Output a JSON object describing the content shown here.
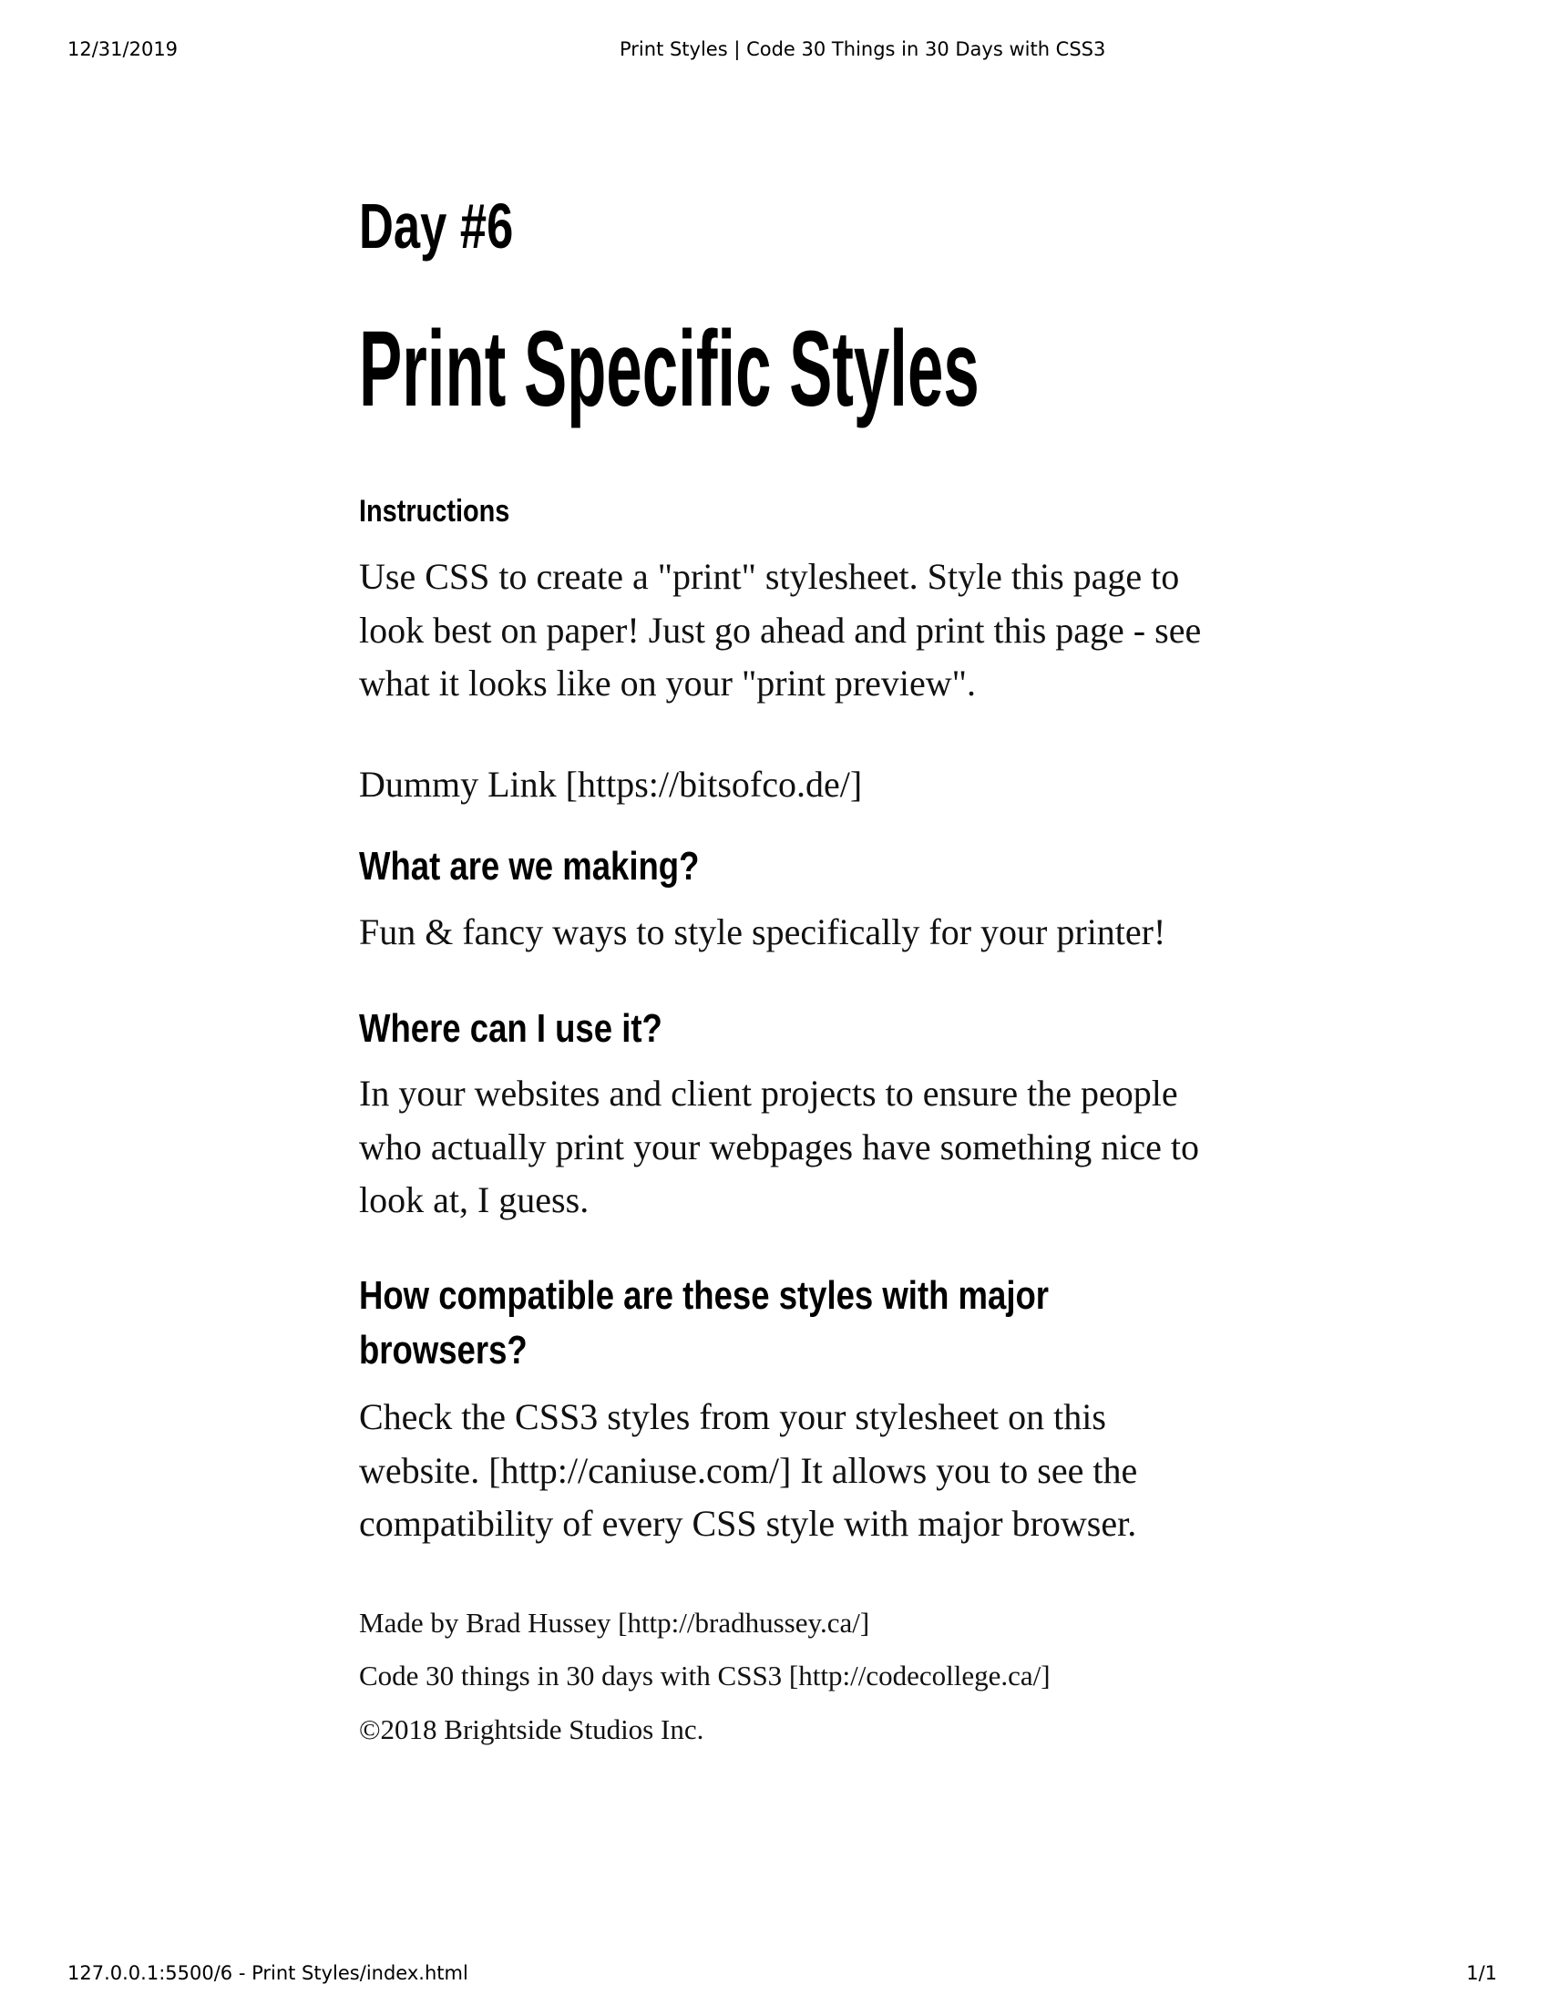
{
  "print_header": {
    "date": "12/31/2019",
    "title": "Print Styles | Code 30 Things in 30 Days with CSS3"
  },
  "print_footer": {
    "url": "127.0.0.1:5500/6 - Print Styles/index.html",
    "page": "1/1"
  },
  "content": {
    "day": "Day #6",
    "title": "Print Specific Styles",
    "instructions_heading": "Instructions",
    "instructions_text": "Use CSS to create a \"print\" stylesheet. Style this page to look best on paper! Just go ahead and print this page - see what it looks like on your \"print preview\".",
    "dummy_link": "Dummy Link [https://bitsofco.de/]",
    "making_heading": "What are we making?",
    "making_text": "Fun & fancy ways to style specifically for your printer!",
    "where_heading": "Where can I use it?",
    "where_text": "In your websites and client projects to ensure the people who actually print your webpages have something nice to look at, I guess.",
    "compat_heading_line1": "How compatible are these styles with major",
    "compat_heading_line2": "browsers?",
    "compat_text": "Check the CSS3 styles from your stylesheet on this website. [http://caniuse.com/] It allows you to see the compatibility of every CSS style with major browser."
  },
  "footer": {
    "made_by": "Made by Brad Hussey [http://bradhussey.ca/]",
    "course": "Code 30 things in 30 days with CSS3 [http://codecollege.ca/]",
    "copyright": "©2018 Brightside Studios Inc."
  }
}
